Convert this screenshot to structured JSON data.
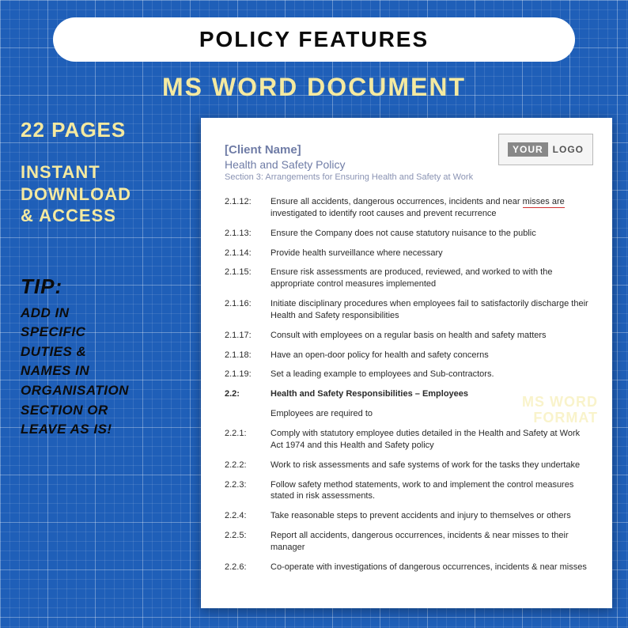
{
  "header": {
    "pill": "POLICY FEATURES",
    "subtitle": "MS WORD DOCUMENT"
  },
  "sidebar": {
    "pages": "22 PAGES",
    "instant": "INSTANT\nDOWNLOAD\n& ACCESS",
    "tip_label": "TIP:",
    "tip_body": "ADD IN\nSPECIFIC\nDUTIES &\nNAMES IN\nORGANISATION\nSECTION OR\nLEAVE AS IS!"
  },
  "doc": {
    "logo_your": "YOUR",
    "logo_logo": "LOGO",
    "client": "[Client Name]",
    "title": "Health and Safety Policy",
    "section": "Section 3: Arrangements for Ensuring Health and Safety at Work",
    "watermark": "MS WORD\nFORMAT",
    "items": [
      {
        "n": "2.1.12:",
        "t": "Ensure all accidents, dangerous occurrences, incidents and near ",
        "tail": "misses are",
        "t2": " investigated to identify root causes and prevent recurrence"
      },
      {
        "n": "2.1.13:",
        "t": "Ensure the Company does not cause statutory nuisance to the public"
      },
      {
        "n": "2.1.14:",
        "t": "Provide health surveillance where necessary"
      },
      {
        "n": "2.1.15:",
        "t": "Ensure risk assessments are produced, reviewed, and worked to with the appropriate control measures implemented"
      },
      {
        "n": "2.1.16:",
        "t": "Initiate disciplinary procedures when employees fail to satisfactorily discharge their Health and Safety responsibilities"
      },
      {
        "n": "2.1.17:",
        "t": "Consult with employees on a regular basis on health and safety matters"
      },
      {
        "n": "2.1.18:",
        "t": "Have an open-door policy for health and safety concerns"
      },
      {
        "n": "2.1.19:",
        "t": "Set a leading example to employees and Sub-contractors."
      }
    ],
    "sec2_num": "2.2:",
    "sec2_title": "Health and Safety Responsibilities – Employees",
    "sec2_intro": "Employees are required to",
    "items2": [
      {
        "n": "2.2.1:",
        "t": "Comply with statutory employee duties detailed in the Health and Safety at Work Act 1974 and this Health and Safety policy"
      },
      {
        "n": "2.2.2:",
        "t": "Work to risk assessments and safe systems of work for the tasks they undertake"
      },
      {
        "n": "2.2.3:",
        "t": "Follow safety method statements, work to and implement the control measures stated in risk assessments."
      },
      {
        "n": "2.2.4:",
        "t": "Take reasonable steps to prevent accidents and injury to themselves or others"
      },
      {
        "n": "2.2.5:",
        "t": "Report all accidents, dangerous occurrences, incidents & near misses to their manager"
      },
      {
        "n": "2.2.6:",
        "t": "Co-operate with investigations of dangerous occurrences, incidents & near misses"
      }
    ]
  }
}
